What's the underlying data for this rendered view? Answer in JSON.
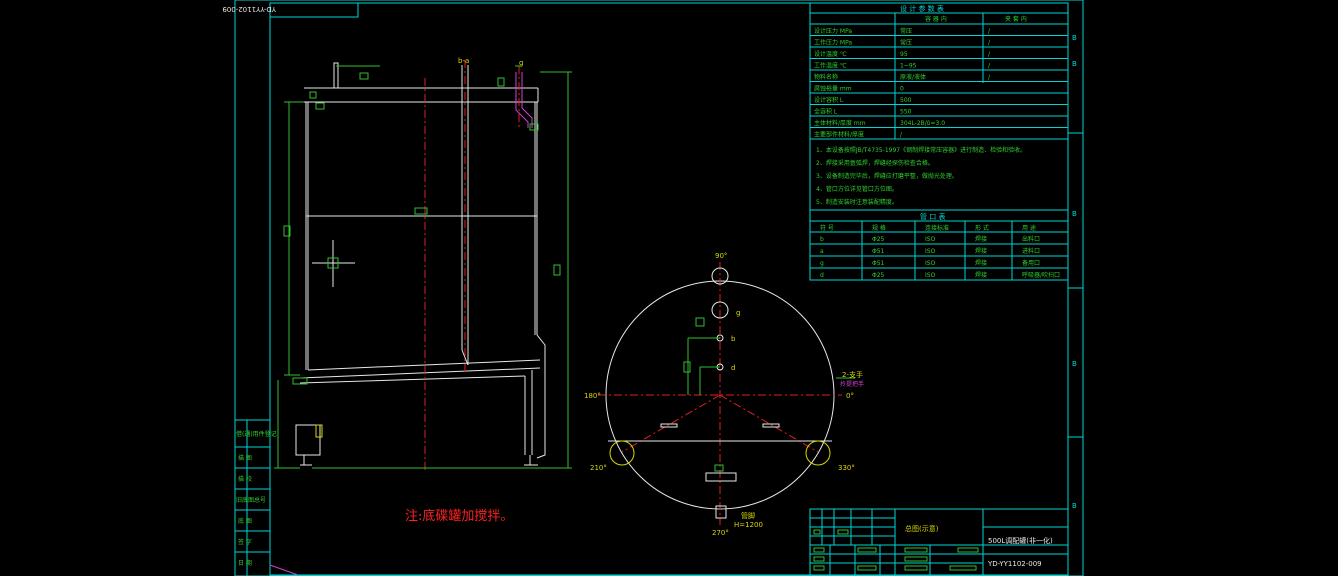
{
  "drawing_number": "YD-YY1102-009",
  "drawing_number_mirrored": "YD-YY1102-009",
  "drawing_number_bottom": "YD-YY1102-009",
  "title_block": {
    "drawing_name": "总图(示意)",
    "product_name": "500L调配罐(非一化)"
  },
  "design_data": {
    "heading": "设 计 参 数 表",
    "col_container": "容 器 内",
    "col_jacket": "夹 套 内",
    "rows": [
      {
        "label": "设计压力  MPa",
        "container": "常压",
        "jacket": "/"
      },
      {
        "label": "工作压力  MPa",
        "container": "常压",
        "jacket": "/"
      },
      {
        "label": "设计温度  ℃",
        "container": "95",
        "jacket": "/"
      },
      {
        "label": "工作温度  ℃",
        "container": "1~95",
        "jacket": "/"
      },
      {
        "label": "物料名称",
        "container": "原液/液体",
        "jacket": "/"
      },
      {
        "label": "腐蚀裕量   mm",
        "container": "0",
        "jacket": ""
      },
      {
        "label": "设计容积    L",
        "container": "500",
        "jacket": ""
      },
      {
        "label": "全容积       L",
        "container": "550",
        "jacket": ""
      },
      {
        "label": "主体材料/厚度   mm",
        "container": "304L-2B/δ=3.0",
        "jacket": ""
      },
      {
        "label": "主要部件材料/厚度",
        "container": "/",
        "jacket": ""
      }
    ]
  },
  "notes": [
    "1、本设备按照JB/T4735-1997《钢制焊接常压容器》进行制造、检验和验收。",
    "2、焊接采用氩弧焊，焊缝经探伤检查合格。",
    "3、设备制造完毕后，焊缝应打磨平整，做抛光处理。",
    "4、管口方位详见管口方位图。",
    "5、制造安装时注意装配精度。"
  ],
  "nozzle_table": {
    "heading": "管 口 表",
    "headers": [
      "符 号",
      "规 格",
      "连接标准",
      "形 式",
      "用 途"
    ],
    "rows": [
      [
        "b",
        "Φ25",
        "ISO",
        "焊接",
        "出料口"
      ],
      [
        "a",
        "Φ51",
        "ISO",
        "焊接",
        "进料口"
      ],
      [
        "g",
        "Φ51",
        "ISO",
        "焊接",
        "备用口"
      ],
      [
        "d",
        "Φ25",
        "ISO",
        "焊接",
        "呼吸器/吹扫口"
      ]
    ]
  },
  "plan_view": {
    "angle_top": "90°",
    "angle_left": "180°",
    "angle_right": "0°",
    "angle_bottom": "270°",
    "angle_bottom_left": "210°",
    "angle_bottom_right": "330°",
    "nozzle_g": "g",
    "nozzle_b": "b",
    "nozzle_d": "d",
    "leg_label": "2-支手",
    "leg_sub": "拎提把手",
    "bottom_label": "H=1200",
    "bottom_tag": "管脚"
  },
  "elevation": {
    "nozzle_b": "b-a",
    "nozzle_g": "g"
  },
  "left_strip": [
    "借(通)用件登记",
    "描 图",
    "描 校",
    "旧底图总号",
    "底 图",
    "签 字",
    "日 期"
  ],
  "note_red": "注:底碟罐加搅拌。",
  "frame_marks": [
    "B",
    "B",
    "B",
    "B",
    "B"
  ]
}
